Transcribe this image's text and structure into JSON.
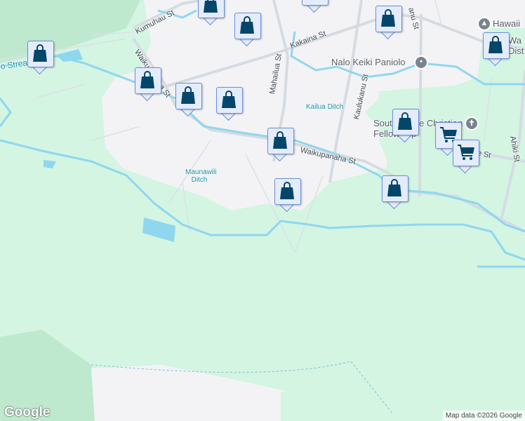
{
  "streets": {
    "kumuhau": "Kumuhau St",
    "waikupanaha_west": "Waikupanaha St",
    "waikupanaha_east": "Waikupanaha St",
    "kakaina": "Kakaina St",
    "mahailua": "Mahailua St",
    "kaulukanu": "Kaulukanu St",
    "kaulukanu_top": "anu St",
    "ahiki": "Ahiki St",
    "partial_e_st": "e St"
  },
  "water": {
    "stream": "lo Stream",
    "kailua_ditch": "Kailua Ditch",
    "maunawili_ditch": "Maunawili Ditch"
  },
  "poi": {
    "nalo": "Nalo Keiki Paniolo",
    "hawaii": "Hawaii",
    "dist": "Wa Dist",
    "church": "South Shore Christian Fellowship"
  },
  "markers": {
    "store_types": [
      "shopping-bag",
      "shopping-cart"
    ]
  },
  "footer": {
    "logo": "Google",
    "attribution": "Map data ©2026 Google"
  }
}
